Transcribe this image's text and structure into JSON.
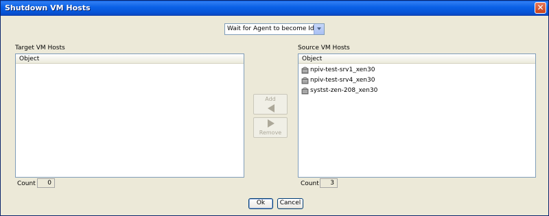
{
  "window": {
    "title": "Shutdown VM Hosts",
    "close_label": "✕"
  },
  "mode_select": {
    "selected": "Wait for Agent to become Idle"
  },
  "target": {
    "label": "Target VM Hosts",
    "column_header": "Object",
    "count_label": "Count",
    "count": "0",
    "items": []
  },
  "source": {
    "label": "Source VM Hosts",
    "column_header": "Object",
    "count_label": "Count",
    "count": "3",
    "items": [
      {
        "name": "npiv-test-srv1_xen30",
        "icon": "vm-host-icon"
      },
      {
        "name": "npiv-test-srv4_xen30",
        "icon": "vm-host-icon"
      },
      {
        "name": "systst-zen-208_xen30",
        "icon": "vm-host-icon"
      }
    ]
  },
  "transfer": {
    "add_label": "Add",
    "remove_label": "Remove",
    "disabled": true
  },
  "buttons": {
    "ok_label": "Ok",
    "cancel_label": "Cancel"
  }
}
